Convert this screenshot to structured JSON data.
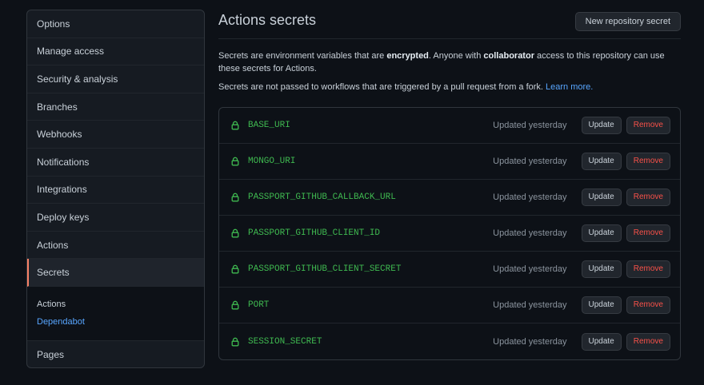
{
  "sidebar": {
    "items": [
      {
        "label": "Options"
      },
      {
        "label": "Manage access"
      },
      {
        "label": "Security & analysis"
      },
      {
        "label": "Branches"
      },
      {
        "label": "Webhooks"
      },
      {
        "label": "Notifications"
      },
      {
        "label": "Integrations"
      },
      {
        "label": "Deploy keys"
      },
      {
        "label": "Actions"
      },
      {
        "label": "Secrets"
      }
    ],
    "sub_items": [
      {
        "label": "Actions"
      },
      {
        "label": "Dependabot"
      }
    ],
    "last_item": {
      "label": "Pages"
    }
  },
  "header": {
    "title": "Actions secrets",
    "new_button": "New repository secret"
  },
  "description": {
    "part1": "Secrets are environment variables that are ",
    "bold1": "encrypted",
    "part2": ". Anyone with ",
    "bold2": "collaborator",
    "part3": " access to this repository can use these secrets for Actions.",
    "line2": "Secrets are not passed to workflows that are triggered by a pull request from a fork. ",
    "link": "Learn more."
  },
  "secrets": [
    {
      "name": "BASE_URI",
      "updated": "Updated yesterday",
      "update": "Update",
      "remove": "Remove"
    },
    {
      "name": "MONGO_URI",
      "updated": "Updated yesterday",
      "update": "Update",
      "remove": "Remove"
    },
    {
      "name": "PASSPORT_GITHUB_CALLBACK_URL",
      "updated": "Updated yesterday",
      "update": "Update",
      "remove": "Remove"
    },
    {
      "name": "PASSPORT_GITHUB_CLIENT_ID",
      "updated": "Updated yesterday",
      "update": "Update",
      "remove": "Remove"
    },
    {
      "name": "PASSPORT_GITHUB_CLIENT_SECRET",
      "updated": "Updated yesterday",
      "update": "Update",
      "remove": "Remove"
    },
    {
      "name": "PORT",
      "updated": "Updated yesterday",
      "update": "Update",
      "remove": "Remove"
    },
    {
      "name": "SESSION_SECRET",
      "updated": "Updated yesterday",
      "update": "Update",
      "remove": "Remove"
    }
  ],
  "colors": {
    "background": "#0d1117",
    "secret_name": "#3fb950",
    "link": "#58a6ff",
    "remove": "#f85149",
    "active_marker": "#f78166"
  },
  "icons": {
    "secret_row": "lock-icon"
  }
}
